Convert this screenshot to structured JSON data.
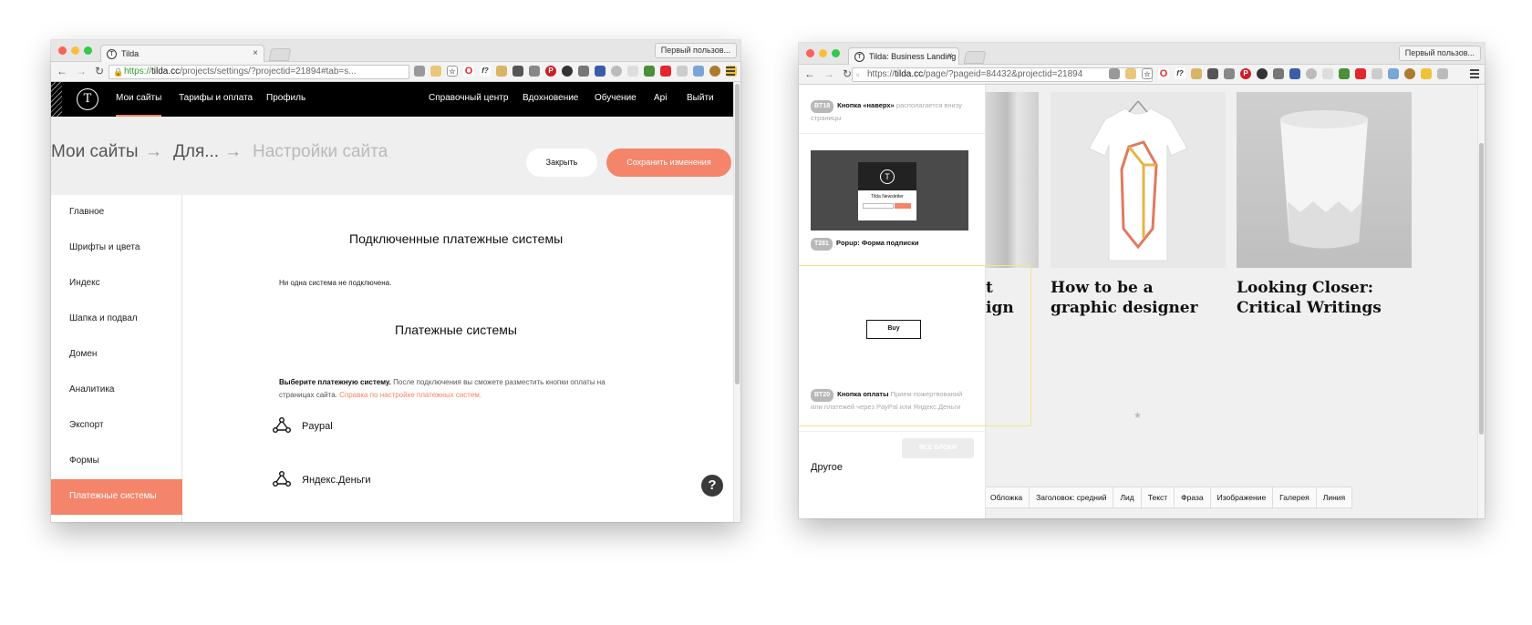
{
  "left_window": {
    "tab_title": "Tilda",
    "tab_close": "×",
    "profile": "Первый пользов...",
    "url_https": "https://",
    "url_host": "tilda.cc",
    "url_rest": "/projects/settings/?projectid=21894#tab=s...",
    "nav": [
      "Мои сайты",
      "Тарифы и оплата",
      "Профиль"
    ],
    "nav_right": [
      "Справочный центр",
      "Вдохновение",
      "Обучение",
      "Api",
      "Выйти"
    ],
    "breadcrumb": [
      "Мои сайты",
      "→",
      "Для...",
      "→",
      "Настройки сайта"
    ],
    "close_label": "Закрыть",
    "save_label": "Сохранить изменения",
    "sidebar": [
      "Главное",
      "Шрифты и цвета",
      "Индекс",
      "Шапка и подвал",
      "Домен",
      "Аналитика",
      "Экспорт",
      "Формы",
      "Платежные системы"
    ],
    "section1_title": "Подключенные платежные системы",
    "section1_note": "Ни одна система не подключена.",
    "section2_title": "Платежные системы",
    "desc_bold": "Выберите платежную систему.",
    "desc_text": " После подключения вы сможете разместить кнопки оплаты на страницах сайта. ",
    "desc_link": "Справка по настройке платежных систем.",
    "payments": [
      "Paypal",
      "Яндекс.Деньги"
    ],
    "help": "?"
  },
  "right_window": {
    "tab_title": "Tilda: Business Landing Pa",
    "tab_close": "×",
    "profile": "Первый пользов...",
    "url_https": "https://",
    "url_host": "tilda.cc",
    "url_rest": "/page/?pageid=84432&projectid=21894",
    "blocks": [
      {
        "code": "BT18",
        "title": "Кнопка «наверх»",
        "desc": " располагается внизу страницы"
      },
      {
        "code": "T281",
        "title": "Popup: Форма подписки",
        "desc": ""
      },
      {
        "code": "BT20",
        "title": "Кнопка оплаты",
        "desc": " Прием пожертвований или платежей через PayPal или Яндекс.Деньги"
      }
    ],
    "popup_title": "Tilda Newsletter",
    "buy_label": "Buy",
    "all_blocks": "ВСЕ БЛОКИ",
    "other": "Другое",
    "cut_title": [
      "t",
      "ign"
    ],
    "product_titles": [
      [
        "How to be a",
        "graphic designer"
      ],
      [
        "Looking Closer:",
        "Critical Writings"
      ]
    ],
    "star": "★",
    "chips": [
      "Обложка",
      "Заголовок: средний",
      "Лид",
      "Текст",
      "Фраза",
      "Изображение",
      "Галерея",
      "Линия"
    ],
    "help": "?"
  },
  "colors": {
    "accent": "#f4846a",
    "nav_bg": "#000000",
    "selection": "#f2e58a"
  },
  "icons": [
    "back-icon",
    "forward-icon",
    "reload-icon",
    "lock-icon",
    "tilda-logo-icon",
    "network-icon",
    "help-icon",
    "menu-icon"
  ]
}
